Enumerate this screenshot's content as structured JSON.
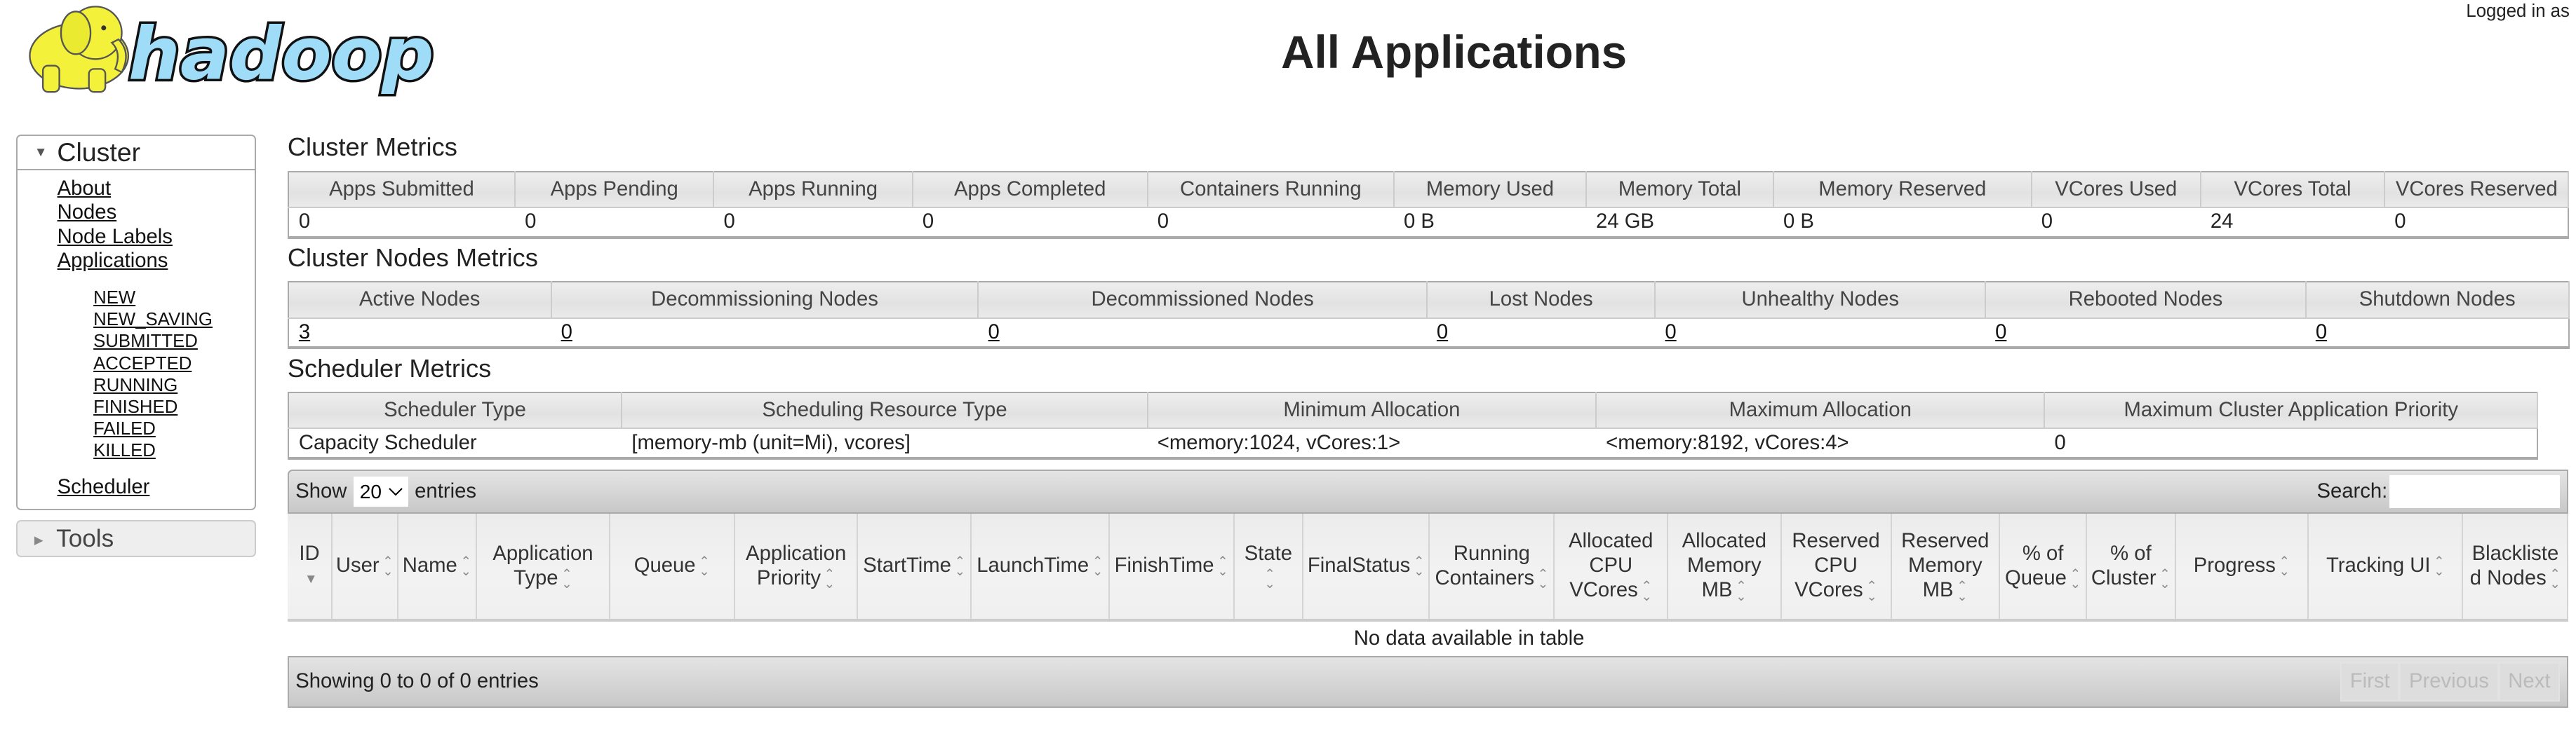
{
  "header": {
    "logo_text": "hadoop",
    "title": "All Applications",
    "login": "Logged in as"
  },
  "nav": {
    "cluster": "Cluster",
    "links": [
      "About",
      "Nodes",
      "Node Labels",
      "Applications"
    ],
    "states": [
      "NEW",
      "NEW_SAVING",
      "SUBMITTED",
      "ACCEPTED",
      "RUNNING",
      "FINISHED",
      "FAILED",
      "KILLED"
    ],
    "scheduler": "Scheduler",
    "tools": "Tools"
  },
  "cluster_metrics": {
    "title": "Cluster Metrics",
    "headers": [
      "Apps Submitted",
      "Apps Pending",
      "Apps Running",
      "Apps Completed",
      "Containers Running",
      "Memory Used",
      "Memory Total",
      "Memory Reserved",
      "VCores Used",
      "VCores Total",
      "VCores Reserved"
    ],
    "values": [
      "0",
      "0",
      "0",
      "0",
      "0",
      "0 B",
      "24 GB",
      "0 B",
      "0",
      "24",
      "0"
    ]
  },
  "nodes_metrics": {
    "title": "Cluster Nodes Metrics",
    "headers": [
      "Active Nodes",
      "Decommissioning Nodes",
      "Decommissioned Nodes",
      "Lost Nodes",
      "Unhealthy Nodes",
      "Rebooted Nodes",
      "Shutdown Nodes"
    ],
    "values": [
      "3",
      "0",
      "0",
      "0",
      "0",
      "0",
      "0"
    ]
  },
  "scheduler_metrics": {
    "title": "Scheduler Metrics",
    "headers": [
      "Scheduler Type",
      "Scheduling Resource Type",
      "Minimum Allocation",
      "Maximum Allocation",
      "Maximum Cluster Application Priority"
    ],
    "values": [
      "Capacity Scheduler",
      "[memory-mb (unit=Mi), vcores]",
      "<memory:1024, vCores:1>",
      "<memory:8192, vCores:4>",
      "0"
    ]
  },
  "apps": {
    "show": "Show",
    "entries": "entries",
    "page_size": "20",
    "search_label": "Search:",
    "search_value": "",
    "columns": [
      "ID",
      "User",
      "Name",
      "Application Type",
      "Queue",
      "Application Priority",
      "StartTime",
      "LaunchTime",
      "FinishTime",
      "State",
      "FinalStatus",
      "Running Containers",
      "Allocated CPU VCores",
      "Allocated Memory MB",
      "Reserved CPU VCores",
      "Reserved Memory MB",
      "% of Queue",
      "% of Cluster",
      "Progress",
      "Tracking UI",
      "Blacklisted Nodes"
    ],
    "sorted_column": "ID",
    "empty": "No data available in table",
    "info": "Showing 0 to 0 of 0 entries",
    "pager": [
      "First",
      "Previous",
      "Next"
    ]
  }
}
